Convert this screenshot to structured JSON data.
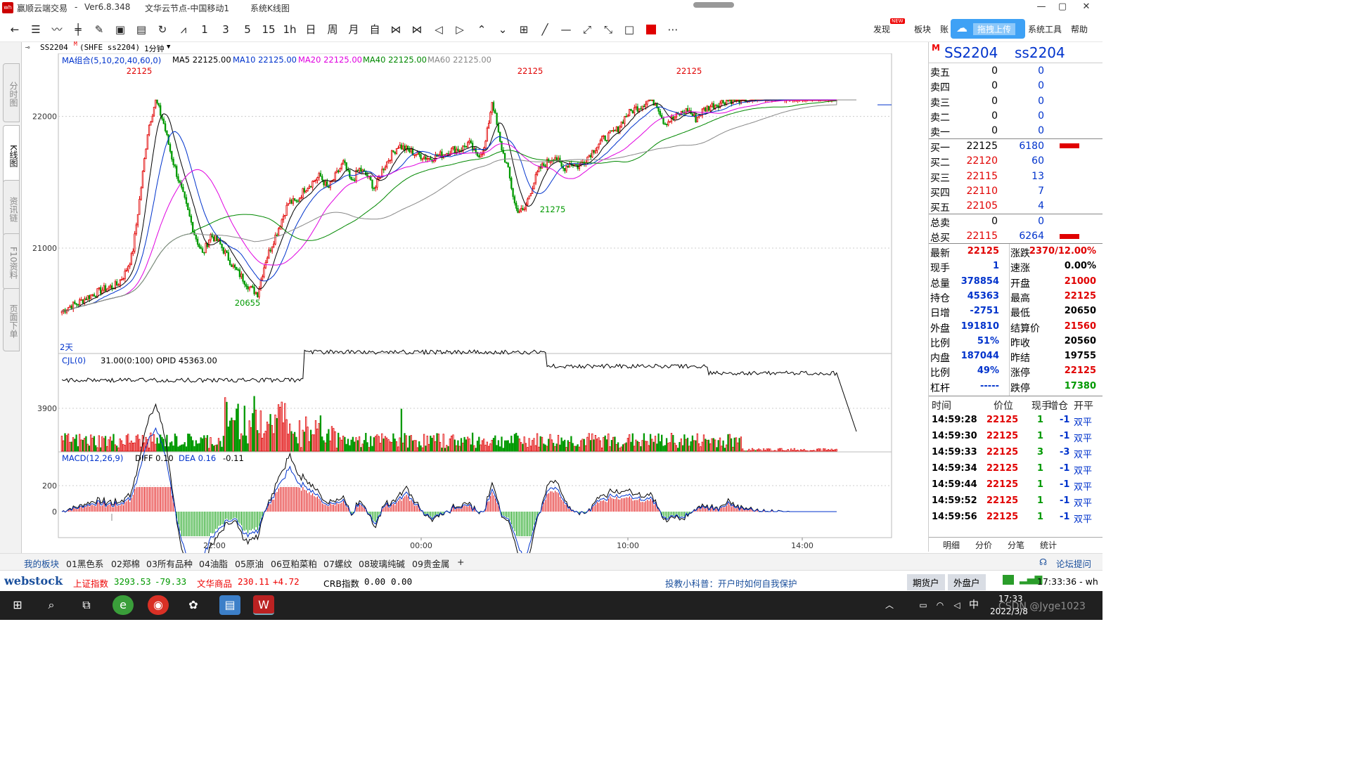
{
  "window": {
    "app": "赢顺云端交易",
    "version": "Ver6.8.348",
    "node": "文华云节点-中国移动1",
    "view": "系统K线图"
  },
  "toolbar": {
    "periods": [
      "1",
      "3",
      "5",
      "15",
      "1h",
      "日",
      "周",
      "月",
      "自"
    ],
    "right": {
      "discover": "发现",
      "new_badge": "NEW",
      "sector": "板块",
      "account": "账",
      "upload": "拖拽上传",
      "tools": "系统工具",
      "help": "帮助"
    }
  },
  "sidebar": {
    "tabs": [
      "分时图",
      "K线图",
      "资讯链",
      "F10资料",
      "页面下单"
    ]
  },
  "chart_header": {
    "symbol": "SS2204",
    "flag": "M",
    "exchange": "(SHFE ss2204)",
    "period": "1分钟"
  },
  "ma_legend": {
    "group": "MA组合(5,10,20,40,60,0)",
    "ma5": "MA5 22125.00",
    "ma10": "MA10 22125.00",
    "ma20": "MA20 22125.00",
    "ma40": "MA40 22125.00",
    "ma60": "MA60 22125.00"
  },
  "volume_legend": {
    "name": "CJL(0)",
    "vol": "31.00(0:100)",
    "opid": "OPID 45363.00"
  },
  "macd_legend": {
    "name": "MACD(12,26,9)",
    "diff": "DIFF 0.10",
    "dea": "DEA 0.16",
    "macd": "-0.11"
  },
  "price_axis": {
    "labels": [
      "22000",
      "21000"
    ],
    "vol_label": "3900",
    "macd_labels": [
      "200",
      "0"
    ]
  },
  "time_axis": [
    "22:00",
    "00:00",
    "10:00",
    "14:00"
  ],
  "annotations": {
    "high1": "22125",
    "high2": "22125",
    "high3": "22125",
    "low1": "20655",
    "low2": "21275",
    "days": "2天"
  },
  "colors": {
    "up": "#e00000",
    "down": "#009900",
    "ma5": "#000000",
    "ma10": "#0033cc",
    "ma20": "#e000e0",
    "ma40": "#008800",
    "ma60": "#888888"
  },
  "chart_data": {
    "type": "candlestick",
    "ylim": [
      20200,
      22350
    ],
    "key_points": [
      {
        "label": "22125",
        "value": 22125
      },
      {
        "label": "20655",
        "value": 20655
      },
      {
        "label": "22125",
        "value": 22125
      },
      {
        "label": "21275",
        "value": 21275
      },
      {
        "label": "22125",
        "value": 22125
      }
    ],
    "close_path": [
      20520,
      20560,
      20580,
      20620,
      20650,
      20680,
      20700,
      20720,
      20800,
      20950,
      21400,
      21900,
      22125,
      21950,
      21700,
      21500,
      21300,
      21100,
      20950,
      21100,
      21050,
      20950,
      20850,
      20780,
      20700,
      20655,
      20900,
      21050,
      21200,
      21350,
      21350,
      21450,
      21500,
      21550,
      21450,
      21550,
      21650,
      21500,
      21600,
      21550,
      21450,
      21600,
      21700,
      21780,
      21750,
      21720,
      21700,
      21680,
      21700,
      21720,
      21750,
      21750,
      21800,
      21700,
      21750,
      22125,
      21800,
      21600,
      21300,
      21275,
      21450,
      21600,
      21650,
      21700,
      21600,
      21650,
      21620,
      21680,
      21750,
      21820,
      21860,
      21900,
      22000,
      22050,
      22080,
      22125,
      22100,
      21950,
      21980,
      22020,
      22050,
      21980,
      22050,
      22080,
      22100,
      22125,
      22125,
      22125,
      22125,
      22125,
      22125,
      22125,
      22125,
      22125,
      22125,
      22125,
      22125,
      22125,
      22125,
      22125
    ]
  },
  "quote": {
    "code": "SS2204",
    "code2": "ss2204",
    "asks": [
      {
        "label": "卖五",
        "price": "0",
        "vol": "0"
      },
      {
        "label": "卖四",
        "price": "0",
        "vol": "0"
      },
      {
        "label": "卖三",
        "price": "0",
        "vol": "0"
      },
      {
        "label": "卖二",
        "price": "0",
        "vol": "0"
      },
      {
        "label": "卖一",
        "price": "0",
        "vol": "0"
      }
    ],
    "bids": [
      {
        "label": "买一",
        "price": "22125",
        "vol": "6180"
      },
      {
        "label": "买二",
        "price": "22120",
        "vol": "60"
      },
      {
        "label": "买三",
        "price": "22115",
        "vol": "13"
      },
      {
        "label": "买四",
        "price": "22110",
        "vol": "7"
      },
      {
        "label": "买五",
        "price": "22105",
        "vol": "4"
      }
    ],
    "total_sell": {
      "label": "总卖",
      "price": "0",
      "vol": "0"
    },
    "total_buy": {
      "label": "总买",
      "price": "22115",
      "vol": "6264"
    },
    "stats_left": [
      [
        "最新",
        "22125"
      ],
      [
        "现手",
        "1"
      ],
      [
        "总量",
        "378854"
      ],
      [
        "持仓",
        "45363"
      ],
      [
        "日增",
        "-2751"
      ],
      [
        "外盘",
        "191810"
      ],
      [
        "比例",
        "51%"
      ],
      [
        "内盘",
        "187044"
      ],
      [
        "比例",
        "49%"
      ],
      [
        "杠杆",
        "-----"
      ]
    ],
    "stats_right": [
      [
        "涨跌",
        "2370/12.00%"
      ],
      [
        "速涨",
        "0.00%"
      ],
      [
        "开盘",
        "21000"
      ],
      [
        "最高",
        "22125"
      ],
      [
        "最低",
        "20650"
      ],
      [
        "结算价",
        "21560"
      ],
      [
        "昨收",
        "20560"
      ],
      [
        "昨结",
        "19755"
      ],
      [
        "涨停",
        "22125"
      ],
      [
        "跌停",
        "17380"
      ]
    ],
    "ticks_header": [
      "时间",
      "价位",
      "现手",
      "增仓",
      "开平"
    ],
    "ticks": [
      [
        "14:59:28",
        "22125",
        "1",
        "-1",
        "双平"
      ],
      [
        "14:59:30",
        "22125",
        "1",
        "-1",
        "双平"
      ],
      [
        "14:59:33",
        "22125",
        "3",
        "-3",
        "双平"
      ],
      [
        "14:59:34",
        "22125",
        "1",
        "-1",
        "双平"
      ],
      [
        "14:59:44",
        "22125",
        "1",
        "-1",
        "双平"
      ],
      [
        "14:59:52",
        "22125",
        "1",
        "-1",
        "双平"
      ],
      [
        "14:59:56",
        "22125",
        "1",
        "-1",
        "双平"
      ]
    ],
    "tabs": [
      "明细",
      "分价",
      "分笔",
      "统计"
    ]
  },
  "bottom_tabs": [
    "我的板块",
    "01黑色系",
    "02郑棉",
    "03所有品种",
    "04油脂",
    "05原油",
    "06豆粕菜粕",
    "07螺纹",
    "08玻璃纯碱",
    "09贵金属",
    "+"
  ],
  "forum": "论坛提问",
  "status": {
    "brand": "webstock",
    "idx1_name": "上证指数",
    "idx1_val": "3293.53",
    "idx1_chg": "-79.33",
    "idx2_name": "文华商品",
    "idx2_val": "230.11",
    "idx2_chg": "+4.72",
    "idx3_name": "CRB指数",
    "idx3_val": "0.00",
    "idx3_chg": "0.00",
    "notice": "投教小科普：开户时如何自我保护",
    "btn1": "期货户",
    "btn2": "外盘户",
    "time": "17:33:36 - wh"
  },
  "taskbar": {
    "ime": "中",
    "time": "17:33",
    "date": "2022/3/8",
    "watermark": "CSDN @Jyge1023"
  }
}
